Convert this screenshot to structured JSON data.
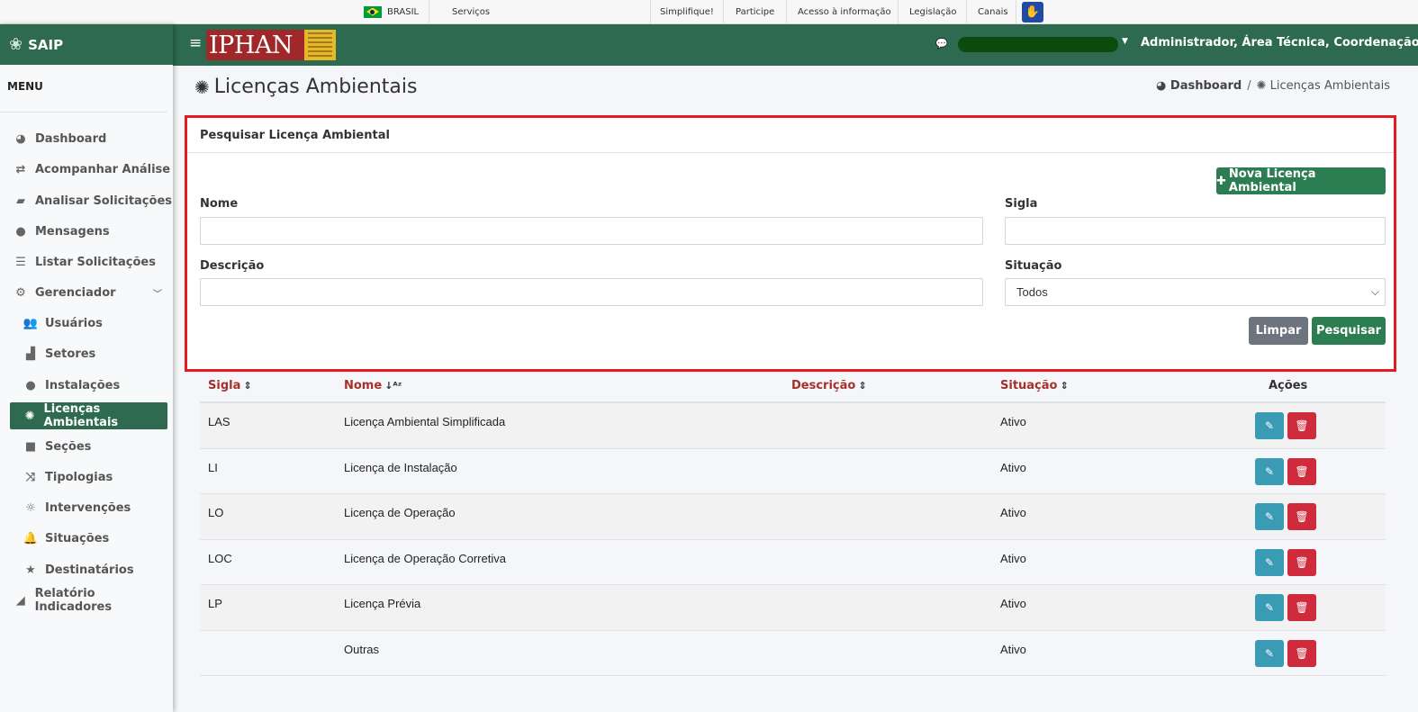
{
  "govbar": {
    "country": "BRASIL",
    "servicos": "Serviços",
    "links": [
      "Simplifique!",
      "Participe",
      "Acesso à informação",
      "Legislação",
      "Canais"
    ]
  },
  "sidebar": {
    "brand": "SAIP",
    "menu_title": "MENU",
    "items": [
      {
        "label": "Dashboard",
        "icon": "dashboard-icon"
      },
      {
        "label": "Acompanhar Análise",
        "icon": "exchange-icon"
      },
      {
        "label": "Analisar Solicitações",
        "icon": "book-icon"
      },
      {
        "label": "Mensagens",
        "icon": "comments-icon"
      },
      {
        "label": "Listar Solicitações",
        "icon": "list-icon"
      },
      {
        "label": "Gerenciador",
        "icon": "gears-icon"
      },
      {
        "label": "Usuários",
        "icon": "users-icon"
      },
      {
        "label": "Setores",
        "icon": "industry-icon"
      },
      {
        "label": "Instalações",
        "icon": "circle-icon"
      },
      {
        "label": "Licenças Ambientais",
        "icon": "certificate-icon"
      },
      {
        "label": "Seções",
        "icon": "square-icon"
      },
      {
        "label": "Tipologias",
        "icon": "random-icon"
      },
      {
        "label": "Intervenções",
        "icon": "sun-icon"
      },
      {
        "label": "Situações",
        "icon": "bell-icon"
      },
      {
        "label": "Destinatários",
        "icon": "star-icon"
      },
      {
        "label": "Relatório Indicadores",
        "icon": "chart-area-icon"
      }
    ]
  },
  "header": {
    "logo_text": "IPHAN",
    "user": "Administrador, Área Técnica, Coordenação..."
  },
  "page": {
    "title": "Licenças Ambientais",
    "breadcrumb": [
      "Dashboard",
      "Licenças Ambientais"
    ]
  },
  "search": {
    "title": "Pesquisar Licença Ambiental",
    "new_button": "Nova Licença Ambiental",
    "fields": {
      "nome_label": "Nome",
      "nome_value": "",
      "sigla_label": "Sigla",
      "sigla_value": "",
      "descricao_label": "Descrição",
      "descricao_value": "",
      "situacao_label": "Situação",
      "situacao_value": "Todos"
    },
    "clear_button": "Limpar",
    "search_button": "Pesquisar"
  },
  "table": {
    "headers": [
      "Sigla",
      "Nome",
      "Descrição",
      "Situação",
      "Ações"
    ],
    "rows": [
      {
        "sigla": "LAS",
        "nome": "Licença Ambiental Simplificada",
        "descricao": "",
        "situacao": "Ativo"
      },
      {
        "sigla": "LI",
        "nome": "Licença de Instalação",
        "descricao": "",
        "situacao": "Ativo"
      },
      {
        "sigla": "LO",
        "nome": "Licença de Operação",
        "descricao": "",
        "situacao": "Ativo"
      },
      {
        "sigla": "LOC",
        "nome": "Licença de Operação Corretiva",
        "descricao": "",
        "situacao": "Ativo"
      },
      {
        "sigla": "LP",
        "nome": "Licença Prévia",
        "descricao": "",
        "situacao": "Ativo"
      },
      {
        "sigla": "",
        "nome": "Outras",
        "descricao": "",
        "situacao": "Ativo"
      }
    ]
  },
  "colors": {
    "primary_green": "#2d6a4f",
    "button_green": "#2d7d52",
    "highlight_red": "#e31b23",
    "header_link_red": "#a5312a",
    "edit_blue": "#3a9bb5",
    "delete_red": "#d02b3c"
  }
}
